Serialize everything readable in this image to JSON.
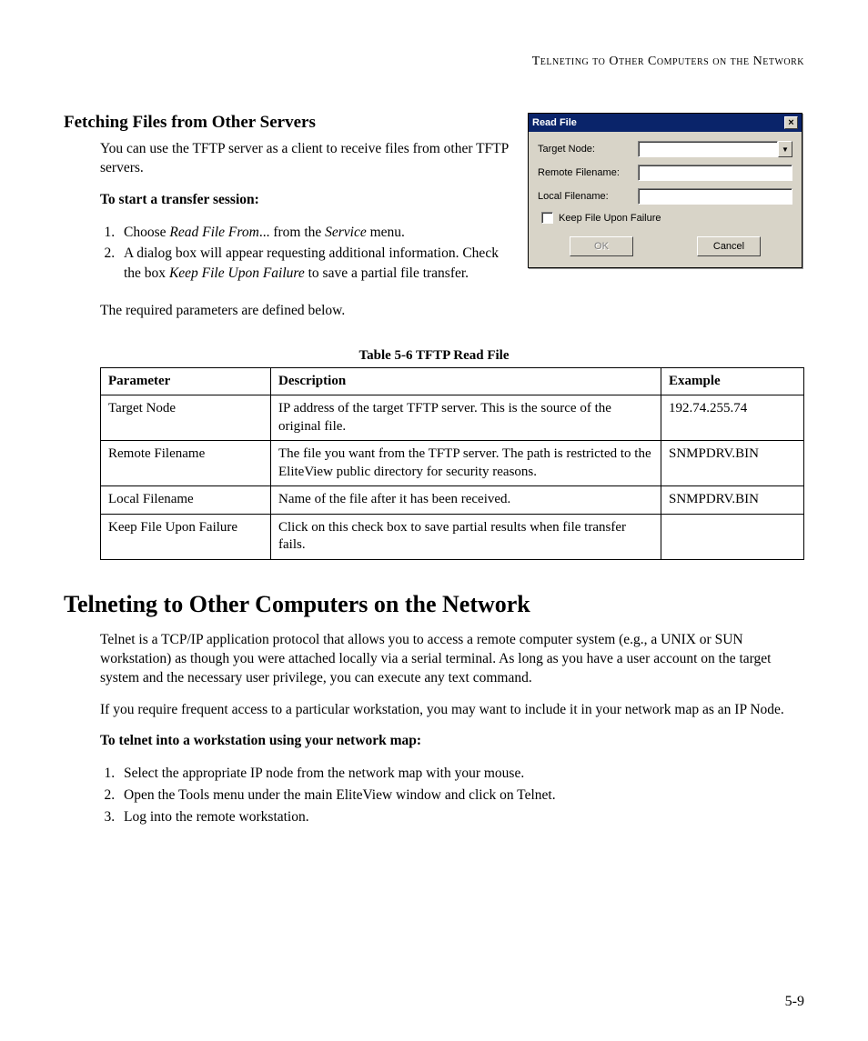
{
  "running_head": "Telneting to Other Computers on the Network",
  "section1": {
    "heading": "Fetching Files from Other Servers",
    "intro": "You can use the TFTP server as a client to receive files from other TFTP servers.",
    "start_label": "To start a transfer session:",
    "step1_a": "Choose ",
    "step1_i": "Read File From",
    "step1_b": "... from the ",
    "step1_i2": "Service",
    "step1_c": " menu.",
    "step2_a": "A dialog box will appear requesting additional information. Check the box ",
    "step2_i": "Keep File Upon Failure",
    "step2_b": " to save a partial file transfer.",
    "outro": "The required parameters are defined below."
  },
  "dialog": {
    "title": "Read File",
    "target_node": "Target Node:",
    "remote_filename": "Remote Filename:",
    "local_filename": "Local Filename:",
    "keep_file": "Keep File Upon Failure",
    "ok": "OK",
    "cancel": "Cancel",
    "close_glyph": "×",
    "arrow_glyph": "▼"
  },
  "table": {
    "caption": "Table 5-6  TFTP Read File",
    "headers": {
      "param": "Parameter",
      "desc": "Description",
      "ex": "Example"
    },
    "rows": [
      {
        "param": "Target Node",
        "desc": "IP address of the target TFTP server. This is the source of the original file.",
        "ex": "192.74.255.74"
      },
      {
        "param": "Remote Filename",
        "desc": "The file you want from the TFTP server. The path is restricted to the EliteView public directory for security reasons.",
        "ex": "SNMPDRV.BIN"
      },
      {
        "param": "Local Filename",
        "desc": "Name of the file after it has been received.",
        "ex": "SNMPDRV.BIN"
      },
      {
        "param": "Keep File Upon Failure",
        "desc": "Click on this check box to save partial results when file transfer fails.",
        "ex": ""
      }
    ]
  },
  "section2": {
    "heading": "Telneting to Other Computers on the Network",
    "para1": "Telnet is a TCP/IP application protocol that allows you to access a remote computer system (e.g., a UNIX or SUN workstation) as though you were attached locally via a serial terminal. As long as you have a user account on the target system and the necessary user privilege, you can execute any text command.",
    "para2": "If you require frequent access to a particular workstation, you may want to include it in your network map as an IP Node.",
    "steps_label": "To telnet into a workstation using your network map:",
    "steps": [
      "Select the appropriate IP node from the network map with your mouse.",
      "Open the Tools menu under the main EliteView window and click on Telnet.",
      "Log into the remote workstation."
    ]
  },
  "page_number": "5-9"
}
